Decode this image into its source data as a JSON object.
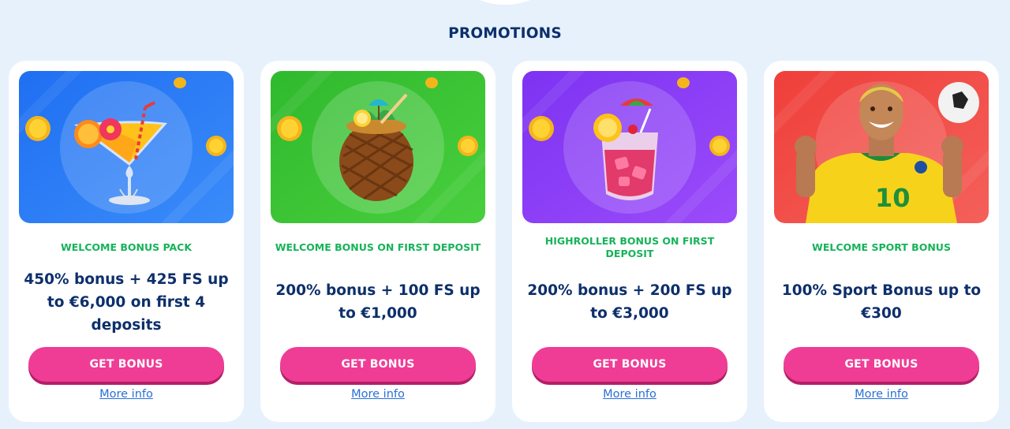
{
  "section": {
    "title": "PROMOTIONS"
  },
  "colors": {
    "page_bg": "#e6f1fc",
    "title": "#0d2f6b",
    "type_green": "#16b35a",
    "button": "#ef3d96",
    "link": "#2b6fd6"
  },
  "promotions": [
    {
      "type": "WELCOME BONUS PACK",
      "title": "450% bonus + 425 FS up to €6,000 on first 4 deposits",
      "button": "GET BONUS",
      "more": "More info",
      "banner_color": "#2a7cf4",
      "image": "cocktail-glass-icon"
    },
    {
      "type": "WELCOME BONUS ON FIRST DEPOSIT",
      "title": "200% bonus + 100 FS up to €1,000",
      "button": "GET BONUS",
      "more": "More info",
      "banner_color": "#35c233",
      "image": "pineapple-drink-icon"
    },
    {
      "type": "HIGHROLLER BONUS ON FIRST DEPOSIT",
      "title": "200% bonus + 200 FS up to €3,000",
      "button": "GET BONUS",
      "more": "More info",
      "banner_color": "#8a3cf7",
      "image": "fruit-punch-glass-icon"
    },
    {
      "type": "WELCOME SPORT BONUS",
      "title": "100% Sport Bonus up to €300",
      "button": "GET BONUS",
      "more": "More info",
      "banner_color": "#f04a43",
      "image": "football-player-icon"
    }
  ]
}
